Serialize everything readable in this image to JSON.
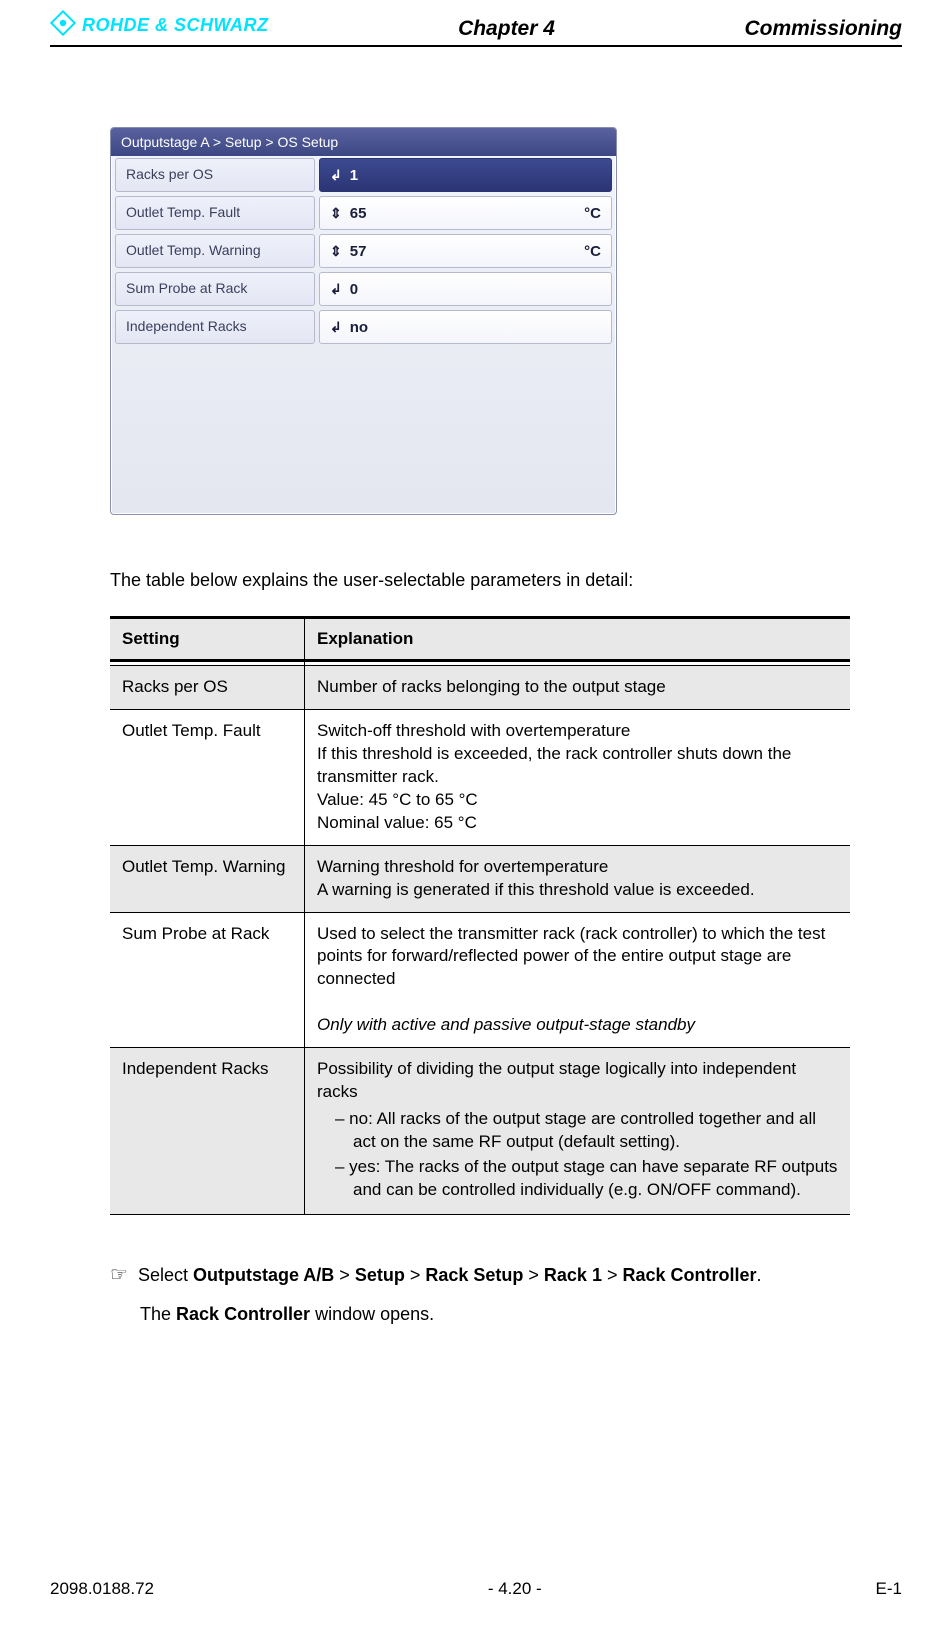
{
  "header": {
    "brand": "ROHDE & SCHWARZ",
    "chapter": "Chapter 4",
    "title": "Commissioning"
  },
  "ui": {
    "breadcrumb": "Outputstage A  > Setup > OS Setup",
    "rows": [
      {
        "label": "Racks per OS",
        "glyph": "↲",
        "value": "1",
        "unit": "",
        "selected": true
      },
      {
        "label": "Outlet Temp. Fault",
        "glyph": "⇕",
        "value": "65",
        "unit": "°C",
        "selected": false
      },
      {
        "label": "Outlet Temp. Warning",
        "glyph": "⇕",
        "value": "57",
        "unit": "°C",
        "selected": false
      },
      {
        "label": "Sum Probe at Rack",
        "glyph": "↲",
        "value": "0",
        "unit": "",
        "selected": false
      },
      {
        "label": "Independent Racks",
        "glyph": "↲",
        "value": "no",
        "unit": "",
        "selected": false
      }
    ]
  },
  "intro": "The table below explains the user-selectable parameters in detail:",
  "table": {
    "head": {
      "c1": "Setting",
      "c2": "Explanation"
    },
    "rows": [
      {
        "setting": "Racks per OS",
        "explanation": "Number of racks belonging to the output stage"
      },
      {
        "setting": "Outlet Temp. Fault",
        "explanation": "Switch-off threshold with overtemperature\nIf this threshold is exceeded, the rack controller shuts down the transmitter rack.\nValue: 45 °C to 65 °C\nNominal value: 65 °C"
      },
      {
        "setting": "Outlet Temp. Warning",
        "explanation": "Warning threshold for overtemperature\nA warning is generated if this threshold value is exceeded."
      },
      {
        "setting": "Sum Probe at Rack",
        "explanation": "Used to select the transmitter rack (rack controller) to which the test points for forward/reflected power of the entire output stage are connected",
        "note": "Only with active and passive output-stage standby"
      },
      {
        "setting": "Independent Racks",
        "explanation": "Possibility of dividing the output stage logically into independent racks",
        "bullets": [
          "no: All racks of the output stage are controlled together and all act on the same RF output (default setting).",
          "yes: The racks of the output stage can have separate RF outputs and can be controlled individually (e.g. ON/OFF command)."
        ]
      }
    ]
  },
  "instruction": {
    "pre": "Select ",
    "path": [
      "Outputstage A/B",
      "Setup",
      "Rack Setup",
      "Rack 1",
      "Rack Controller"
    ],
    "sep": " > ",
    "post": "."
  },
  "follow_pre": "The ",
  "follow_bold": "Rack Controller",
  "follow_post": " window opens.",
  "footer": {
    "left": "2098.0188.72",
    "center": "- 4.20 -",
    "right": "E-1"
  }
}
